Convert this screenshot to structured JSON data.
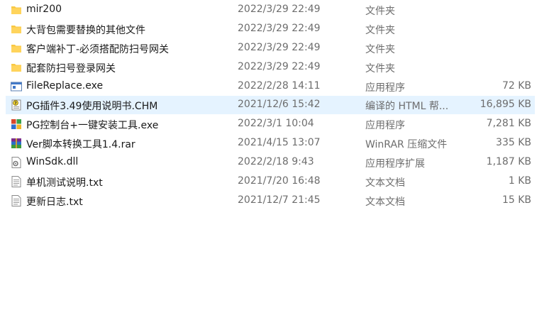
{
  "files": [
    {
      "name": "mir200",
      "date": "2022/3/29 22:49",
      "type": "文件夹",
      "size": "",
      "icon": "folder-icon"
    },
    {
      "name": "大背包需要替换的其他文件",
      "date": "2022/3/29 22:49",
      "type": "文件夹",
      "size": "",
      "icon": "folder-icon"
    },
    {
      "name": "客户端补丁-必须搭配防扫号网关",
      "date": "2022/3/29 22:49",
      "type": "文件夹",
      "size": "",
      "icon": "folder-icon"
    },
    {
      "name": "配套防扫号登录网关",
      "date": "2022/3/29 22:49",
      "type": "文件夹",
      "size": "",
      "icon": "folder-icon"
    },
    {
      "name": "FileReplace.exe",
      "date": "2022/2/28 14:11",
      "type": "应用程序",
      "size": "72 KB",
      "icon": "exe-window-icon"
    },
    {
      "name": "PG插件3.49使用说明书.CHM",
      "date": "2021/12/6 15:42",
      "type": "编译的 HTML 帮...",
      "size": "16,895 KB",
      "icon": "chm-help-icon"
    },
    {
      "name": "PG控制台+一键安装工具.exe",
      "date": "2022/3/1 10:04",
      "type": "应用程序",
      "size": "7,281 KB",
      "icon": "app-grid-icon"
    },
    {
      "name": "Ver脚本转换工具1.4.rar",
      "date": "2021/4/15 13:07",
      "type": "WinRAR 压缩文件",
      "size": "335 KB",
      "icon": "winrar-icon"
    },
    {
      "name": "WinSdk.dll",
      "date": "2022/2/18 9:43",
      "type": "应用程序扩展",
      "size": "1,187 KB",
      "icon": "dll-gear-icon"
    },
    {
      "name": "单机测试说明.txt",
      "date": "2021/7/20 16:48",
      "type": "文本文档",
      "size": "1 KB",
      "icon": "text-document-icon"
    },
    {
      "name": "更新日志.txt",
      "date": "2021/12/7 21:45",
      "type": "文本文档",
      "size": "15 KB",
      "icon": "text-document-icon"
    }
  ],
  "selected_index": 5,
  "colors": {
    "selection": "#e5f3ff",
    "folder": "#f8c843",
    "secondary_text": "#6d6d6d"
  }
}
